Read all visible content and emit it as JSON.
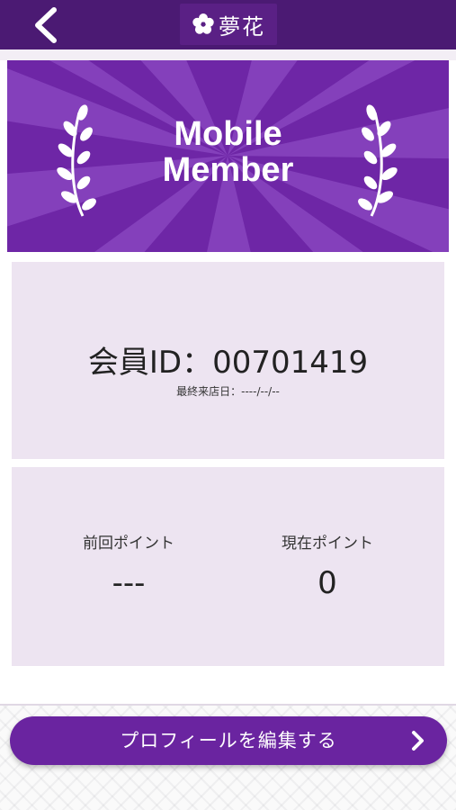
{
  "header": {
    "back_icon": "chevron-left-icon",
    "logo_icon": "flower-icon",
    "logo_text": "夢花"
  },
  "banner": {
    "title_line1": "Mobile",
    "title_line2": "Member",
    "decoration_icon": "laurel-icon"
  },
  "member_card": {
    "id_label": "会員ID：",
    "id_value": "00701419",
    "last_visit_label": "最終来店日：",
    "last_visit_value": "----/--/--"
  },
  "points_card": {
    "previous_label": "前回ポイント",
    "previous_value": "---",
    "current_label": "現在ポイント",
    "current_value": "0"
  },
  "edit_profile": {
    "label": "プロフィールを編集する",
    "icon": "chevron-right-icon"
  },
  "colors": {
    "header": "#4b1a73",
    "banner": "#7a2fb0",
    "card": "#ede4f1",
    "button": "#6a24a0"
  }
}
